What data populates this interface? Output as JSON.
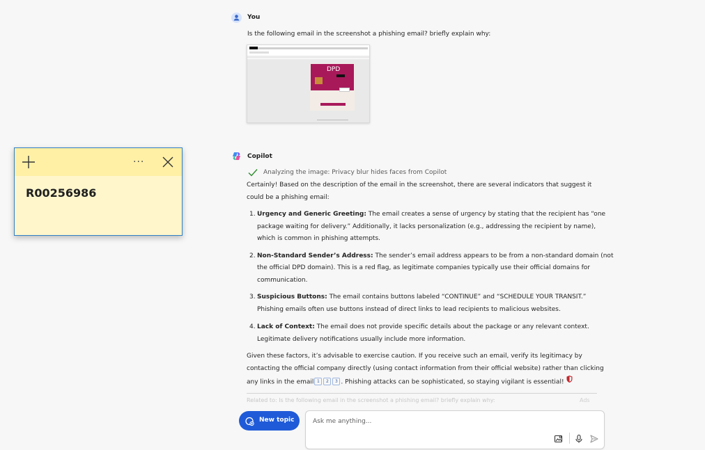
{
  "user": {
    "name": "You",
    "message": "Is the following email in the screenshot a phishing email? briefly explain why:"
  },
  "attachment": {
    "dpd_label": "DPD"
  },
  "copilot": {
    "name": "Copilot",
    "analyzing": "Analyzing the image: Privacy blur hides faces from Copilot",
    "intro_1": "Certainly! Based on the description of the email in the screenshot, there are several indicators that suggest it",
    "intro_2": "could be a phishing email:",
    "items": [
      {
        "num": "1.",
        "title": "Urgency and Generic Greeting:",
        "lines": [
          " The email creates a sense of urgency by stating that the recipient has “one",
          "package waiting for delivery.” Additionally, it lacks personalization (e.g., addressing the recipient by name),",
          "which is common in phishing attempts."
        ]
      },
      {
        "num": "2.",
        "title": "Non-Standard Sender’s Address:",
        "lines": [
          " The sender’s email address appears to be from a non-standard domain (not",
          "the official DPD domain). This is a red flag, as legitimate companies typically use their official domains for",
          "communication."
        ]
      },
      {
        "num": "3.",
        "title": "Suspicious Buttons:",
        "lines": [
          " The email contains buttons labeled “CONTINUE” and “SCHEDULE YOUR TRANSIT.”",
          "Phishing emails often use buttons instead of direct links to lead recipients to malicious websites."
        ]
      },
      {
        "num": "4.",
        "title": "Lack of Context:",
        "lines": [
          " The email does not provide specific details about the package or any relevant context.",
          "Legitimate delivery notifications usually include more information."
        ]
      }
    ],
    "closing_1": "Given these factors, it’s advisable to exercise caution. If you receive such an email, verify its legitimacy by",
    "closing_2": "contacting the official company directly (using contact information from their official website) rather than clicking",
    "closing_3a": "any links in the email",
    "citations": [
      "1",
      "2",
      "3"
    ],
    "closing_3b": ". Phishing attacks can be sophisticated, so staying vigilant is essential!",
    "related": "Related to: Is the following email in the screenshot a phishing email? briefly explain why:",
    "ads": "Ads"
  },
  "composer": {
    "new_topic": "New topic",
    "placeholder": "Ask me anything..."
  },
  "sticky_note": {
    "text": "R00256986",
    "menu_glyph": "···"
  },
  "colors": {
    "accent": "#1f5bd8",
    "sticky_bg": "#fff6cc",
    "sticky_bar": "#fff0a6",
    "dpd_pink": "#a8195a",
    "check_green": "#2e8b2e"
  }
}
